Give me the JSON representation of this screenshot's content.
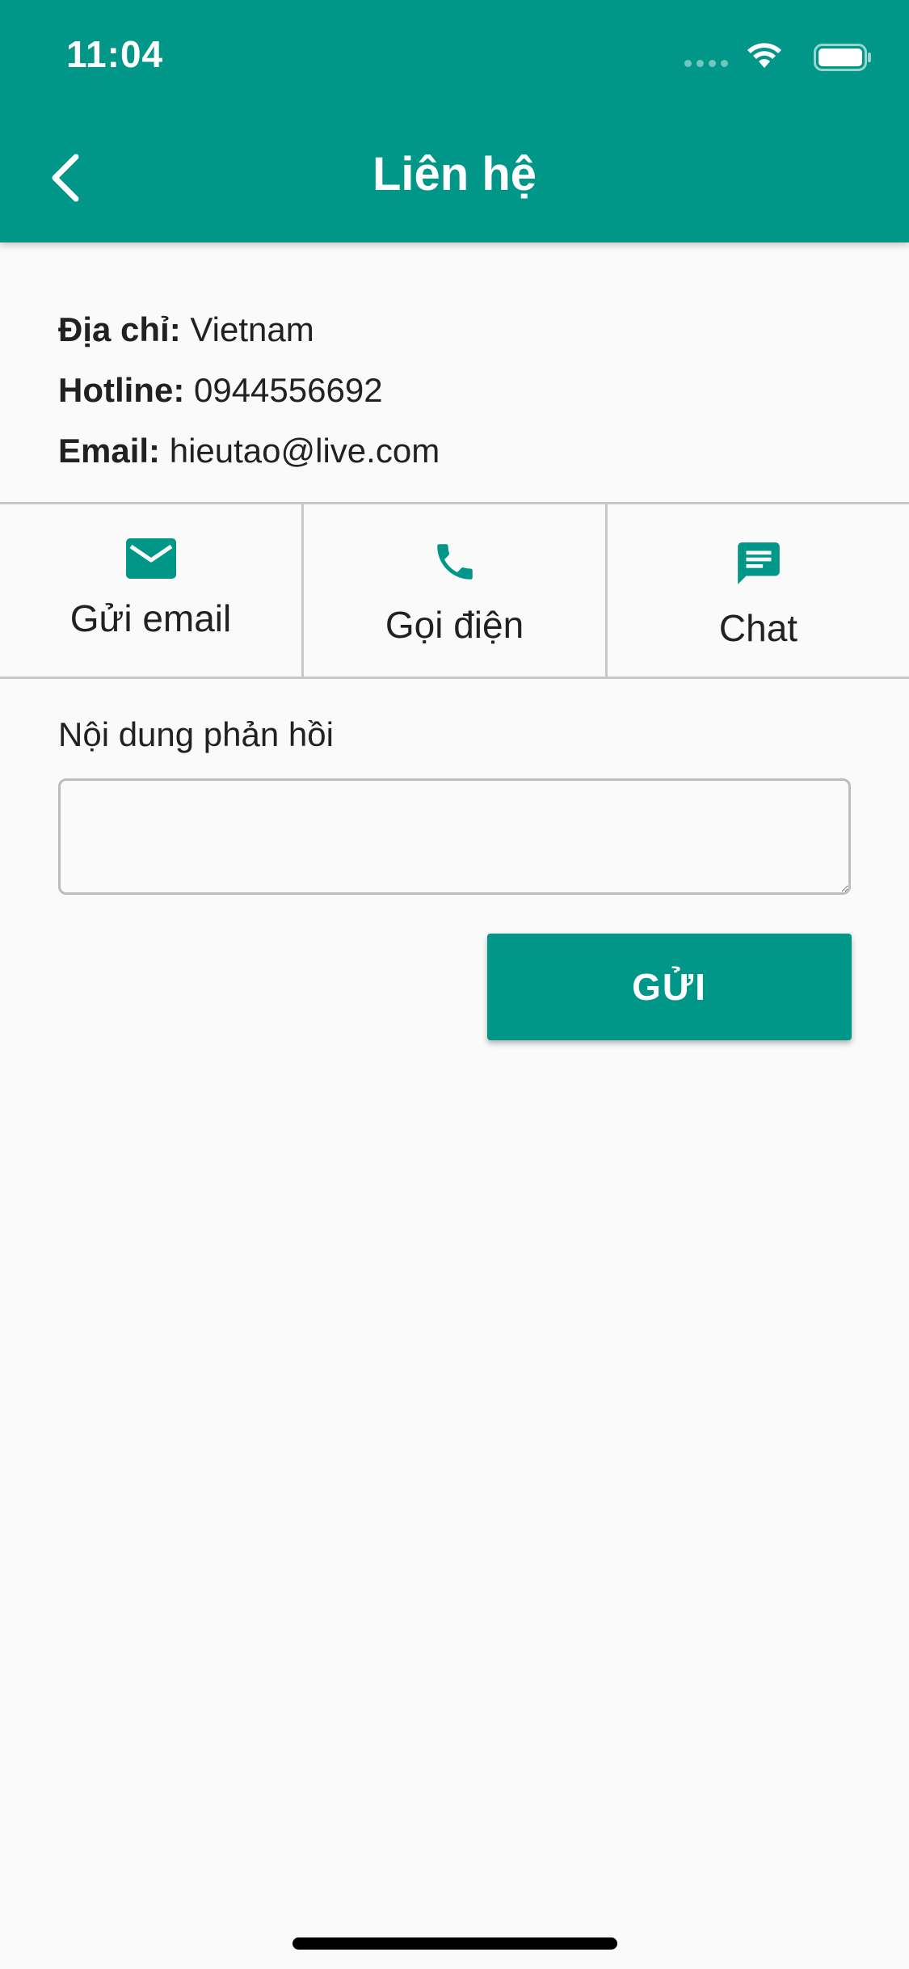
{
  "status_bar": {
    "time": "11:04"
  },
  "appbar": {
    "title": "Liên hệ",
    "back_icon": "chevron-left-icon"
  },
  "contact_info": {
    "address_label": "Địa chỉ:",
    "address_value": "Vietnam",
    "hotline_label": "Hotline:",
    "hotline_value": "0944556692",
    "email_label": "Email:",
    "email_value": "hieutao@live.com"
  },
  "actions": [
    {
      "label": "Gửi email",
      "icon": "mail-icon"
    },
    {
      "label": "Gọi điện",
      "icon": "phone-icon"
    },
    {
      "label": "Chat",
      "icon": "chat-icon"
    }
  ],
  "feedback": {
    "label": "Nội dung phản hồi",
    "value": "",
    "send_label": "GỬI"
  },
  "colors": {
    "primary": "#009688",
    "background": "#fafafa",
    "divider": "#c8c8c8"
  }
}
